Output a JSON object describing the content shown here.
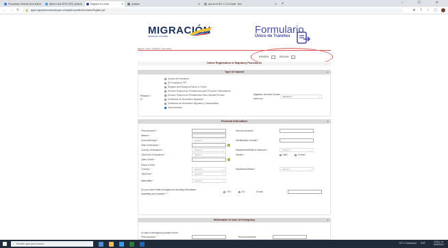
{
  "browser": {
    "tabs": [
      {
        "label": "Procurador General de la Naci",
        "color": "#3b7be0",
        "active": false
      },
      {
        "label": "alerta 1 ase 1576 2020_draws",
        "color": "#4aa3df",
        "active": false
      },
      {
        "label": "Registro En Linea",
        "color": "#2b4b8a",
        "active": true
      },
      {
        "label": "youtube",
        "color": "#777777",
        "active": false
      },
      {
        "label": "que es el NIT 1 2 3 4 Nacti - Bus",
        "color": "#999999",
        "active": false
      }
    ],
    "new_tab": "+",
    "url": "apps.migracioncolombia.gov.co/registro/public/formularioRegistro.jsf",
    "window_controls": "–  ☐  ✕"
  },
  "header": {
    "logo_text": "MIGRACIÓN",
    "logo_tagline": "MIGRACIÓN COLOMBIA",
    "form_title": "Formulario",
    "form_subtitle": "Único de Trámites",
    "breadcrumb": "Está en: Inicio / Registro / Formulario"
  },
  "language": {
    "spanish": "ESPAÑOL",
    "english": "ENGLISH"
  },
  "registration_heading": "Online Registration of Migratory Procedures",
  "type_of_request": {
    "title": "Type of request",
    "toggle": "▲",
    "label": "Request :",
    "label2": "N°",
    "options": [
      "Cédula de Extranjería",
      "SE Expedición PPT",
      "Registro de Extranjeros Menor a 7 años",
      "Permiso Temporal de Permanencia para Promover Permanencia",
      "Permiso Temporal de Permanencia Para Cambiar Permiso",
      "Certificado de Movimiento Migratorio",
      "Certificado de Movimiento Migratorio y Nacionalidad",
      "Salvoconducto"
    ],
    "checked_option": "Salvoconducto",
    "center_label": "Migration Services Center",
    "center_label2": "have you :",
    "center_value": "BOGOTÁ"
  },
  "personal": {
    "title": "Personal information",
    "toggle": "▲",
    "first_surname": "First surname",
    "second_surname": "Second surname",
    "names": "Names",
    "document_type": "Document type",
    "identification_number": "Identification number",
    "date_of_issuance": "Date of issuance",
    "country_of_issuance": "Country of issuance",
    "department_of_issuance": "Department/State of issuance",
    "city_of_issuance": "City/Town of issuance",
    "gender": "Gender",
    "gender_options": [
      "Male",
      "Female"
    ],
    "date_of_birth": "Date of birth",
    "place_of_birth": "Place of birth",
    "country": "Country",
    "department": "Department/State",
    "city": "City/Town",
    "nationality": "Nationality",
    "email_question": "Do you have email and approves sending information",
    "email_question2": "regarding your request ?",
    "yes": "YES",
    "no": "NO",
    "email": "E-mail",
    "select_placeholder": "-SELECT-",
    "required": "*"
  },
  "emergency": {
    "title": "Information in case of emergency",
    "toggle": "▲",
    "intro": "In case of emergency please inform:",
    "first_surname": "First surname",
    "second_surname": "Second surname"
  },
  "taskbar": {
    "search_placeholder": "Escribe aquí para buscar",
    "weather": "20°C Chubascos",
    "lang": "ESP",
    "time": "4:24 p. m.",
    "date": "5/05/2021"
  }
}
